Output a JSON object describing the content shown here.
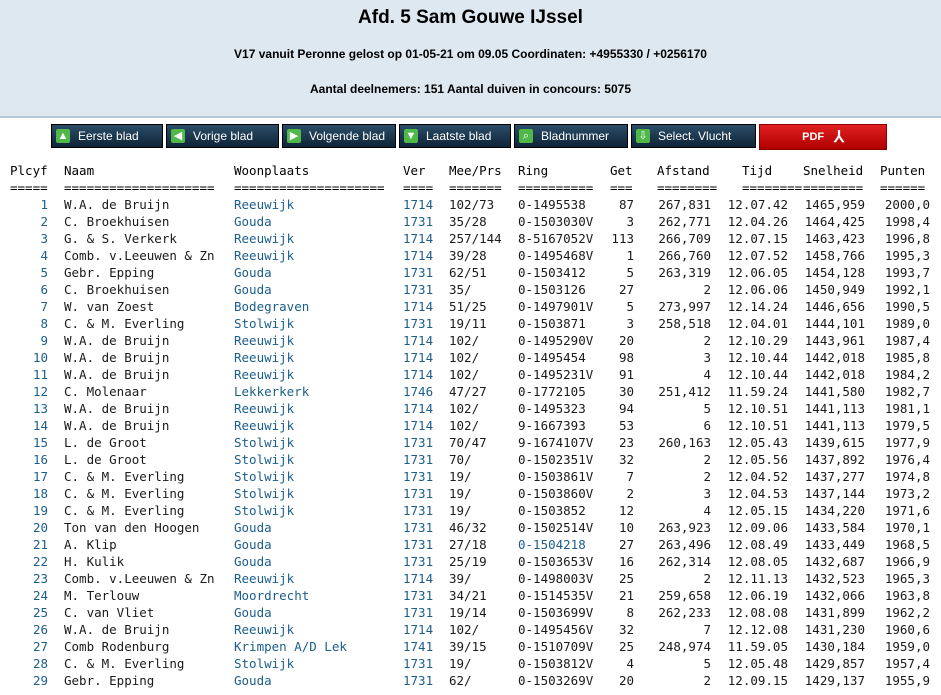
{
  "header": {
    "title": "Afd. 5 Sam Gouwe IJssel",
    "line1": "V17 vanuit Peronne gelost op 01-05-21 om 09.05 Coordinaten: +4955330 / +0256170",
    "line2": "Aantal deelnemers: 151 Aantal duiven in concours: 5075"
  },
  "toolbar": {
    "first": "Eerste blad",
    "prev": "Vorige blad",
    "next": "Volgende blad",
    "last": "Laatste blad",
    "page": "Bladnummer",
    "select": "Select. Vlucht",
    "pdf": "PDF"
  },
  "columns": {
    "pl": "Plcyf",
    "nm": "Naam",
    "wp": "Woonplaats",
    "ve": "Ver",
    "me": "Mee/Prs",
    "ri": "Ring",
    "ge": "Get",
    "af": "Afstand",
    "ti": "Tijd",
    "sn": "Snelheid",
    "pu": "Punten"
  },
  "separators": {
    "pl": "=====",
    "nm": "====================",
    "wp": "====================",
    "ve": "====",
    "me": "=======",
    "ri": "==========",
    "ge": "===",
    "af": "========",
    "ti": "========",
    "sn": "========",
    "pu": "======"
  },
  "rows": [
    [
      "1",
      "W.A. de Bruijn",
      "Reeuwijk",
      "1714",
      "102/73",
      "0-1495538",
      "87",
      "267,831",
      "12.07.42",
      "1465,959",
      "2000,0"
    ],
    [
      "2",
      "C. Broekhuisen",
      "Gouda",
      "1731",
      "35/28",
      "0-1503030V",
      "3",
      "262,771",
      "12.04.26",
      "1464,425",
      "1998,4"
    ],
    [
      "3",
      "G. & S. Verkerk",
      "Reeuwijk",
      "1714",
      "257/144",
      "8-5167052V",
      "113",
      "266,709",
      "12.07.15",
      "1463,423",
      "1996,8"
    ],
    [
      "4",
      "Comb. v.Leeuwen & Zn",
      "Reeuwijk",
      "1714",
      "39/28",
      "0-1495468V",
      "1",
      "266,760",
      "12.07.52",
      "1458,766",
      "1995,3"
    ],
    [
      "5",
      "Gebr. Epping",
      "Gouda",
      "1731",
      "62/51",
      "0-1503412",
      "5",
      "263,319",
      "12.06.05",
      "1454,128",
      "1993,7"
    ],
    [
      "6",
      "C. Broekhuisen",
      "Gouda",
      "1731",
      "35/",
      "0-1503126",
      "27",
      "2",
      "12.06.06",
      "1450,949",
      "1992,1"
    ],
    [
      "7",
      "W. van Zoest",
      "Bodegraven",
      "1714",
      "51/25",
      "0-1497901V",
      "5",
      "273,997",
      "12.14.24",
      "1446,656",
      "1990,5"
    ],
    [
      "8",
      "C. & M. Everling",
      "Stolwijk",
      "1731",
      "19/11",
      "0-1503871",
      "3",
      "258,518",
      "12.04.01",
      "1444,101",
      "1989,0"
    ],
    [
      "9",
      "W.A. de Bruijn",
      "Reeuwijk",
      "1714",
      "102/",
      "0-1495290V",
      "20",
      "2",
      "12.10.29",
      "1443,961",
      "1987,4"
    ],
    [
      "10",
      "W.A. de Bruijn",
      "Reeuwijk",
      "1714",
      "102/",
      "0-1495454",
      "98",
      "3",
      "12.10.44",
      "1442,018",
      "1985,8"
    ],
    [
      "11",
      "W.A. de Bruijn",
      "Reeuwijk",
      "1714",
      "102/",
      "0-1495231V",
      "91",
      "4",
      "12.10.44",
      "1442,018",
      "1984,2"
    ],
    [
      "12",
      "C. Molenaar",
      "Lekkerkerk",
      "1746",
      "47/27",
      "0-1772105",
      "30",
      "251,412",
      "11.59.24",
      "1441,580",
      "1982,7"
    ],
    [
      "13",
      "W.A. de Bruijn",
      "Reeuwijk",
      "1714",
      "102/",
      "0-1495323",
      "94",
      "5",
      "12.10.51",
      "1441,113",
      "1981,1"
    ],
    [
      "14",
      "W.A. de Bruijn",
      "Reeuwijk",
      "1714",
      "102/",
      "9-1667393",
      "53",
      "6",
      "12.10.51",
      "1441,113",
      "1979,5"
    ],
    [
      "15",
      "L. de Groot",
      "Stolwijk",
      "1731",
      "70/47",
      "9-1674107V",
      "23",
      "260,163",
      "12.05.43",
      "1439,615",
      "1977,9"
    ],
    [
      "16",
      "L. de Groot",
      "Stolwijk",
      "1731",
      "70/",
      "0-1502351V",
      "32",
      "2",
      "12.05.56",
      "1437,892",
      "1976,4"
    ],
    [
      "17",
      "C. & M. Everling",
      "Stolwijk",
      "1731",
      "19/",
      "0-1503861V",
      "7",
      "2",
      "12.04.52",
      "1437,277",
      "1974,8"
    ],
    [
      "18",
      "C. & M. Everling",
      "Stolwijk",
      "1731",
      "19/",
      "0-1503860V",
      "2",
      "3",
      "12.04.53",
      "1437,144",
      "1973,2"
    ],
    [
      "19",
      "C. & M. Everling",
      "Stolwijk",
      "1731",
      "19/",
      "0-1503852",
      "12",
      "4",
      "12.05.15",
      "1434,220",
      "1971,6"
    ],
    [
      "20",
      "Ton van den Hoogen",
      "Gouda",
      "1731",
      "46/32",
      "0-1502514V",
      "10",
      "263,923",
      "12.09.06",
      "1433,584",
      "1970,1"
    ],
    [
      "21",
      "A. Klip",
      "Gouda",
      "1731",
      "27/18",
      "0-1504218",
      "27",
      "263,496",
      "12.08.49",
      "1433,449",
      "1968,5"
    ],
    [
      "22",
      "H. Kulik",
      "Gouda",
      "1731",
      "25/19",
      "0-1503653V",
      "16",
      "262,314",
      "12.08.05",
      "1432,687",
      "1966,9"
    ],
    [
      "23",
      "Comb. v.Leeuwen & Zn",
      "Reeuwijk",
      "1714",
      "39/",
      "0-1498003V",
      "25",
      "2",
      "12.11.13",
      "1432,523",
      "1965,3"
    ],
    [
      "24",
      "M. Terlouw",
      "Moordrecht",
      "1731",
      "34/21",
      "0-1514535V",
      "21",
      "259,658",
      "12.06.19",
      "1432,066",
      "1963,8"
    ],
    [
      "25",
      "C. van Vliet",
      "Gouda",
      "1731",
      "19/14",
      "0-1503699V",
      "8",
      "262,233",
      "12.08.08",
      "1431,899",
      "1962,2"
    ],
    [
      "26",
      "W.A. de Bruijn",
      "Reeuwijk",
      "1714",
      "102/",
      "0-1495456V",
      "32",
      "7",
      "12.12.08",
      "1431,230",
      "1960,6"
    ],
    [
      "27",
      "Comb Rodenburg",
      "Krimpen A/D Lek",
      "1741",
      "39/15",
      "0-1510709V",
      "25",
      "248,974",
      "11.59.05",
      "1430,184",
      "1959,0"
    ],
    [
      "28",
      "C. & M. Everling",
      "Stolwijk",
      "1731",
      "19/",
      "0-1503812V",
      "4",
      "5",
      "12.05.48",
      "1429,857",
      "1957,4"
    ],
    [
      "29",
      "Gebr. Epping",
      "Gouda",
      "1731",
      "62/",
      "0-1503269V",
      "20",
      "2",
      "12.09.15",
      "1429,137",
      "1955,9"
    ]
  ]
}
